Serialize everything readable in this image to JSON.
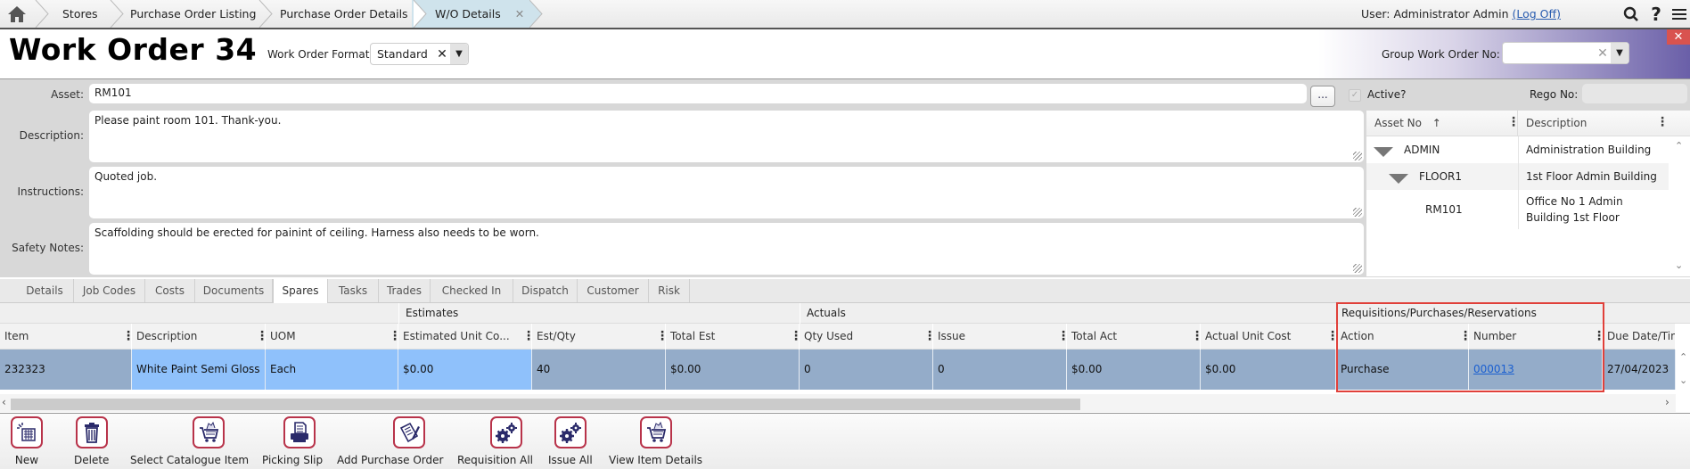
{
  "breadcrumb": {
    "items": [
      "Stores",
      "Purchase Order Listing",
      "Purchase Order Details",
      "W/O Details"
    ],
    "active_index": 3
  },
  "user": {
    "prefix": "User: Administrator Admin ",
    "logoff": "(Log Off)"
  },
  "header": {
    "title": "Work Order 34",
    "format_label": "Work Order Format",
    "format_value": "Standard",
    "group_label": "Group Work Order No:",
    "group_value": ""
  },
  "form": {
    "asset_label": "Asset:",
    "asset_value": "RM101",
    "browse_label": "...",
    "description_label": "Description:",
    "description_value": "Please paint room 101.  Thank-you.",
    "instructions_label": "Instructions:",
    "instructions_value": "Quoted job.",
    "safety_label": "Safety Notes:",
    "safety_value": "Scaffolding should be erected for painint of ceiling.  Harness also needs to be worn.",
    "active_label": "Active?",
    "active_checked": true,
    "rego_label": "Rego No:",
    "rego_value": ""
  },
  "asset_tree": {
    "columns": [
      "Asset No",
      "Description"
    ],
    "sort_icon": "↑",
    "rows": [
      {
        "asset": "ADMIN",
        "description": "Administration Building",
        "level": 0,
        "expanded": true
      },
      {
        "asset": "FLOOR1",
        "description": "1st Floor Admin Building",
        "level": 1,
        "expanded": true
      },
      {
        "asset": "RM101",
        "description": "Office No 1 Admin Building 1st Floor",
        "level": 2,
        "expanded": false
      }
    ]
  },
  "tabs": [
    "Details",
    "Job Codes",
    "Costs",
    "Documents",
    "Spares",
    "Tasks",
    "Trades",
    "Checked In",
    "Dispatch",
    "Customer",
    "Risk"
  ],
  "active_tab": "Spares",
  "grid": {
    "groups": [
      "Estimates",
      "Actuals",
      "Requisitions/Purchases/Reservations"
    ],
    "columns": [
      "Item",
      "Description",
      "UOM",
      "Estimated Unit Co...",
      "Est/Qty",
      "Total Est",
      "Qty Used",
      "Issue",
      "Total Act",
      "Actual Unit Cost",
      "Action",
      "Number",
      "Due Date/Tin"
    ],
    "rows": [
      [
        "232323",
        "White Paint Semi Gloss",
        "Each",
        "$0.00",
        "40",
        "$0.00",
        "0",
        "0",
        "$0.00",
        "$0.00",
        "Purchase",
        "000013",
        "27/04/2023"
      ]
    ]
  },
  "toolbar": [
    {
      "label": "New",
      "icon": "new-icon"
    },
    {
      "label": "Delete",
      "icon": "trash-icon"
    },
    {
      "label": "Select Catalogue Item",
      "icon": "cart-icon"
    },
    {
      "label": "Picking Slip",
      "icon": "printer-icon"
    },
    {
      "label": "Add Purchase Order",
      "icon": "document-pen-icon"
    },
    {
      "label": "Requisition All",
      "icon": "gears-icon"
    },
    {
      "label": "Issue All",
      "icon": "gears-icon"
    },
    {
      "label": "View Item Details",
      "icon": "cart-icon"
    }
  ],
  "colors": {
    "accent_border": "#b8334a",
    "highlight_box": "#e0403a",
    "row_bg": "#94acc9",
    "row_selected": "#8fc1fb",
    "link": "#1a5fd0"
  }
}
